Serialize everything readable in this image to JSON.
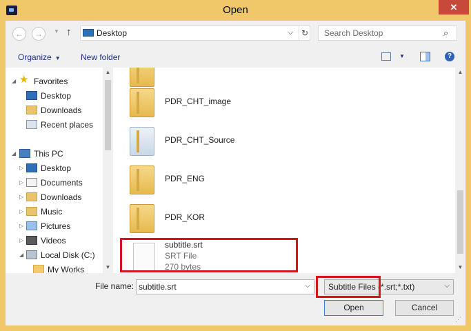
{
  "window": {
    "title": "Open",
    "close_symbol": "✕"
  },
  "address": {
    "location": "Desktop",
    "refresh_symbol": "↻",
    "dropdown_symbol": "⌵"
  },
  "search": {
    "placeholder": "Search Desktop",
    "icon_symbol": "⌕"
  },
  "toolbar": {
    "organize": "Organize",
    "new_folder": "New folder",
    "help_symbol": "?"
  },
  "nav_pane": {
    "favorites": {
      "label": "Favorites",
      "items": [
        "Desktop",
        "Downloads",
        "Recent places"
      ]
    },
    "this_pc": {
      "label": "This PC",
      "items": [
        "Desktop",
        "Documents",
        "Downloads",
        "Music",
        "Pictures",
        "Videos",
        "Local Disk (C:)",
        "My Works"
      ]
    }
  },
  "files": [
    {
      "name": "PDR_CHT_image",
      "icon": "folder-icon"
    },
    {
      "name": "PDR_CHT_Source",
      "icon": "folder-with-documents-icon"
    },
    {
      "name": "PDR_ENG",
      "icon": "folder-icon"
    },
    {
      "name": "PDR_KOR",
      "icon": "folder-icon"
    },
    {
      "name": "subtitle.srt",
      "type": "SRT File",
      "size": "270 bytes",
      "icon": "srt-file-icon",
      "highlighted": true
    }
  ],
  "bottom": {
    "file_name_label": "File name:",
    "file_name_value": "subtitle.srt",
    "file_type_filter": "Subtitle Files (*.srt;*.txt)",
    "open_button": "Open",
    "cancel_button": "Cancel"
  },
  "colors": {
    "frame": "#f0c869",
    "close_button": "#c7493a",
    "highlight": "#d3141c",
    "link_text": "#1e3287"
  }
}
